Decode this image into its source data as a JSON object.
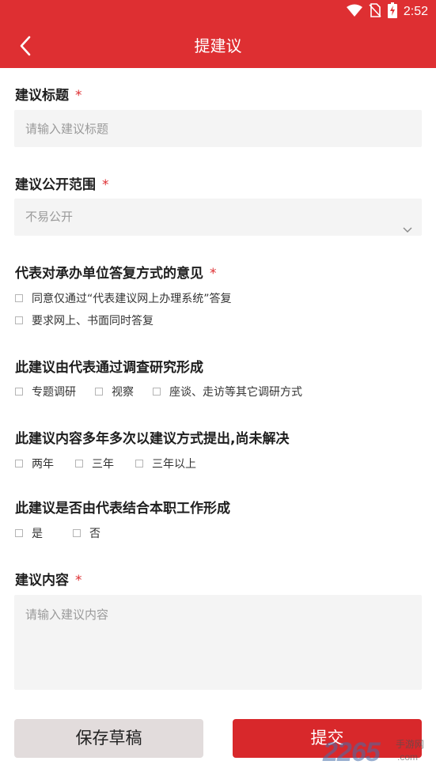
{
  "status_bar": {
    "time": "2:52",
    "icons": [
      "wifi-icon",
      "no-sim-icon",
      "battery-charging-icon"
    ]
  },
  "header": {
    "title": "提建议",
    "back_icon": "chevron-left-icon"
  },
  "form": {
    "title_field": {
      "label": "建议标题",
      "required_mark": "*",
      "placeholder": "请输入建议标题",
      "value": ""
    },
    "scope_field": {
      "label": "建议公开范围",
      "required_mark": "*",
      "selected": "不易公开"
    },
    "reply_opinion": {
      "label": "代表对承办单位答复方式的意见",
      "required_mark": "*",
      "options": [
        {
          "label": "同意仅通过“代表建议网上办理系统”答复",
          "checked": false
        },
        {
          "label": "要求网上、书面同时答复",
          "checked": false
        }
      ]
    },
    "research": {
      "label": "此建议由代表通过调查研究形成",
      "options": [
        {
          "label": "专题调研",
          "checked": false
        },
        {
          "label": "视察",
          "checked": false
        },
        {
          "label": "座谈、走访等其它调研方式",
          "checked": false
        }
      ]
    },
    "repeat": {
      "label": "此建议内容多年多次以建议方式提出,尚未解决",
      "options": [
        {
          "label": "两年",
          "checked": false
        },
        {
          "label": "三年",
          "checked": false
        },
        {
          "label": "三年以上",
          "checked": false
        }
      ]
    },
    "job_related": {
      "label": "此建议是否由代表结合本职工作形成",
      "options": [
        {
          "label": "是",
          "checked": false
        },
        {
          "label": "否",
          "checked": false
        }
      ]
    },
    "content_field": {
      "label": "建议内容",
      "required_mark": "*",
      "placeholder": "请输入建议内容",
      "value": ""
    }
  },
  "actions": {
    "save_draft_label": "保存草稿",
    "submit_label": "提交"
  },
  "watermark": {
    "number": "2265",
    "cn": "手游网",
    "domain": ".com"
  },
  "colors": {
    "brand_red": "#de2f32",
    "submit_red": "#d8282b",
    "draft_gray": "#e2dcdc",
    "input_bg": "#f4f4f4"
  }
}
